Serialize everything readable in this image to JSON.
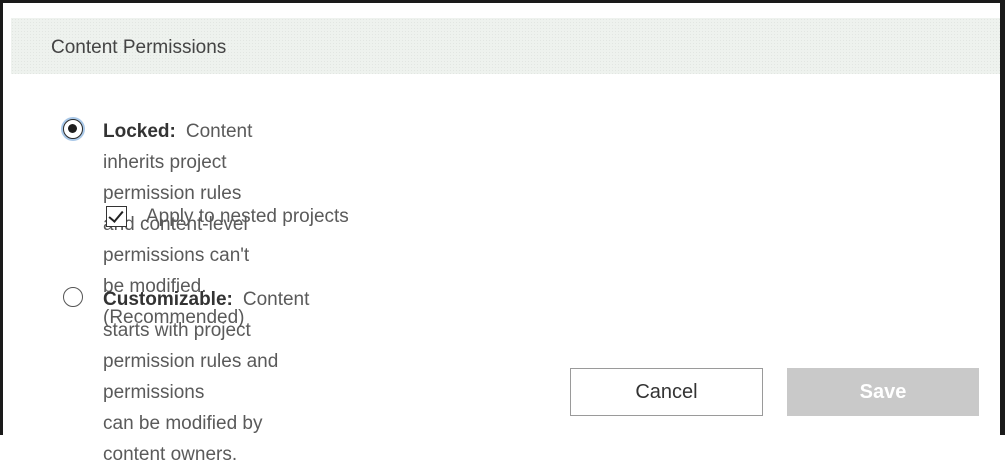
{
  "dialog": {
    "title": "Content Permissions"
  },
  "options": {
    "locked": {
      "label": "Locked:",
      "line1": "Content inherits project permission rules and content-level",
      "line2": "permissions can't be modified. (Recommended)",
      "selected": true
    },
    "nested": {
      "label": "Apply to nested projects",
      "checked": true
    },
    "customizable": {
      "label": "Customizable:",
      "line1": "Content starts with project permission rules and permissions",
      "line2": "can be modified by content owners.",
      "selected": false
    }
  },
  "buttons": {
    "cancel": "Cancel",
    "save": "Save"
  }
}
